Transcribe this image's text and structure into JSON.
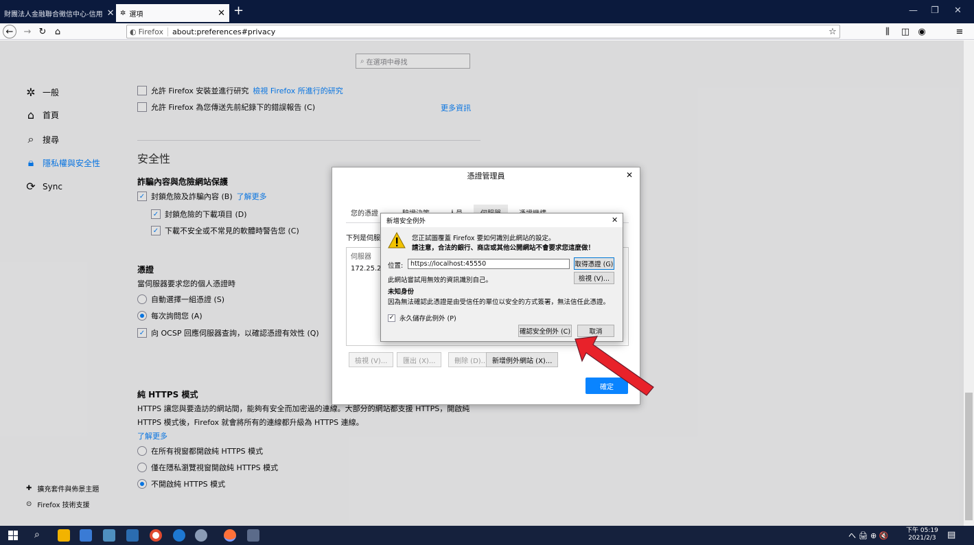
{
  "tabs": [
    {
      "title": "財團法人金融聯合徵信中心-信用 ",
      "close": "✕"
    },
    {
      "title": "選項",
      "close": "✕"
    }
  ],
  "new_tab": "+",
  "window_controls": {
    "minimize": "—",
    "restore": "❐",
    "close": "✕"
  },
  "nav": {
    "back": "←",
    "forward": "→",
    "reload": "↻",
    "home": "⌂",
    "identity": "Firefox",
    "url": "about:preferences#privacy",
    "bookmark_star": "☆",
    "library": "⫼",
    "sidebar": "◫",
    "account": "◉",
    "menu": "≡"
  },
  "search": {
    "placeholder": "在選項中尋找"
  },
  "sidebar": {
    "items": [
      {
        "label": "一般",
        "icon": "gear-icon"
      },
      {
        "label": "首頁",
        "icon": "home-icon"
      },
      {
        "label": "搜尋",
        "icon": "search-icon"
      },
      {
        "label": "隱私權與安全性",
        "icon": "lock-icon"
      },
      {
        "label": "Sync",
        "icon": "sync-icon"
      }
    ],
    "footer": [
      {
        "label": "擴充套件與佈景主題",
        "icon": "puzzle-icon"
      },
      {
        "label": "Firefox 技術支援",
        "icon": "help-icon"
      }
    ]
  },
  "privacy": {
    "studies_label": "允許 Firefox 安裝並進行研究",
    "studies_link": "檢視 Firefox 所進行的研究",
    "crash_label": "允許 Firefox 為您傳送先前紀錄下的錯誤報告 (C)",
    "crash_link": "更多資訊"
  },
  "security": {
    "heading": "安全性",
    "phishing_heading": "詐騙內容與危險網站保護",
    "block_dangerous": "封鎖危險及詐騙內容 (B)",
    "learn_more": "了解更多",
    "block_downloads": "封鎖危險的下載項目 (D)",
    "warn_unwanted": "下載不安全或不常見的軟體時警告您 (C)"
  },
  "certs": {
    "heading": "憑證",
    "desc": "當伺服器要求您的個人憑證時",
    "auto_select": "自動選擇一組憑證 (S)",
    "ask_every": "每次詢問您 (A)",
    "ocsp": "向 OCSP 回應伺服器查詢，以確認憑證有效性 (Q)"
  },
  "https_only": {
    "heading": "純 HTTPS 模式",
    "desc_line1": "HTTPS 讓您與要造訪的網站間，能夠有安全而加密過的連線。大部分的網站都支援 HTTPS，開啟純",
    "desc_line2": "HTTPS 模式後，Firefox 就會將所有的連線都升級為 HTTPS 連線。",
    "learn_more": "了解更多",
    "all_windows": "在所有視窗都開啟純 HTTPS 模式",
    "private_only": "僅在隱私瀏覽視窗開啟純 HTTPS 模式",
    "disabled": "不開啟純 HTTPS 模式"
  },
  "cert_manager": {
    "title": "憑證管理員",
    "close": "✕",
    "tabs": [
      "您的憑證",
      "驗證決策",
      "人員",
      "伺服器",
      "憑證機構"
    ],
    "list_desc": "下列是伺服器",
    "column_server": "伺服器",
    "row_server": "172.25.2",
    "buttons": {
      "view": "檢視 (V)...",
      "export": "匯出 (X)...",
      "delete": "刪除 (D)...",
      "add_exception": "新增例外網站 (X)..."
    },
    "ok": "確定"
  },
  "add_exception": {
    "title": "新增安全例外",
    "close": "✕",
    "warn_line1": "您正試圖覆蓋 Firefox 要如何識別此網站的設定。",
    "warn_line2": "請注意，合法的銀行、商店或其他公開網站不會要求您這麼做！",
    "location_label": "位置:",
    "location_value": "https://localhost:45550",
    "get_cert": "取得憑證 (G)",
    "invalid_info": "此網站嘗試用無效的資訊識別自己。",
    "view": "檢視 (V)...",
    "unknown_identity": "未知身份",
    "unknown_desc": "因為無法確認此憑證是由受信任的單位以安全的方式簽署，無法信任此憑證。",
    "permanent": "永久儲存此例外 (P)",
    "confirm": "確認安全例外 (C)",
    "cancel": "取消"
  },
  "taskbar": {
    "clock_time": "下午 05:19",
    "clock_date": "2021/2/3",
    "tray": "へ 🖨 ⊕ 🔇"
  },
  "colors": {
    "accent": "#0a84ff",
    "titlebar": "#0b1a3d",
    "arrow": "#e8222a",
    "taskbar": "#15213d"
  }
}
